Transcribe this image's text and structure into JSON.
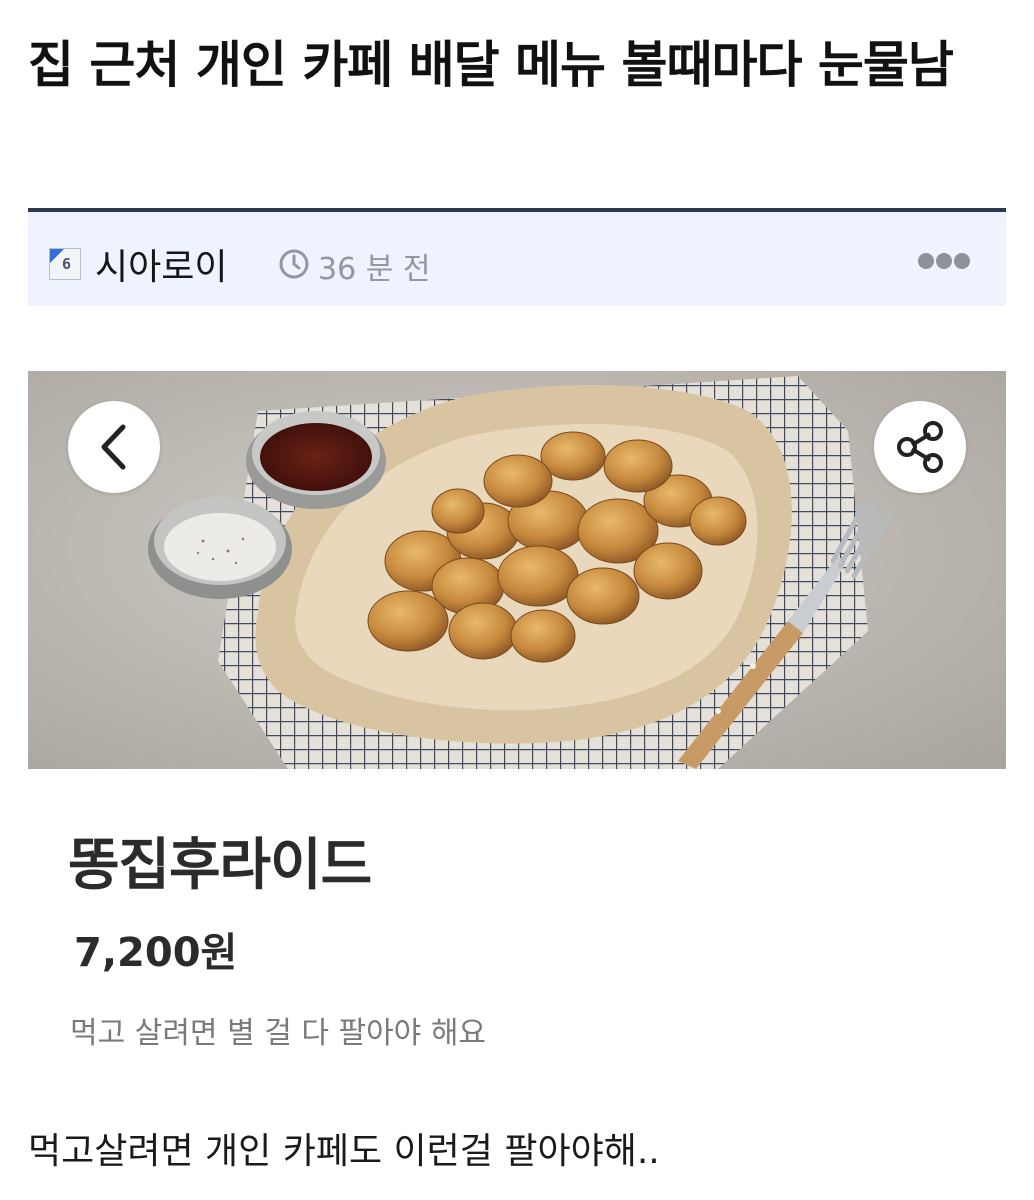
{
  "post": {
    "title": "집 근처 개인 카페 배달 메뉴 볼때마다 눈물남",
    "author": "시아로이",
    "level": "6",
    "time_ago": "36 분 전",
    "more_icon": "ellipsis-icon",
    "body": "먹고살려면 개인 카페도 이런걸 팔아야해.."
  },
  "embedded_screenshot": {
    "back_icon": "chevron-left-icon",
    "share_icon": "share-icon",
    "product_name": "똥집후라이드",
    "price": "7,200원",
    "description": "먹고 살려면 별 걸 다 팔아야 해요"
  },
  "colors": {
    "meta_bar_bg": "#eef3fd",
    "meta_bar_border": "#2e3a4e",
    "muted_text": "#9297a0"
  }
}
